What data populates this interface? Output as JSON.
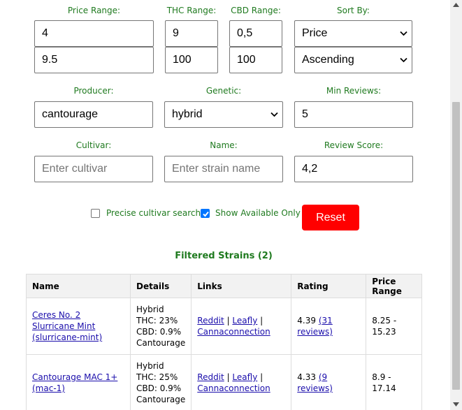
{
  "filters": {
    "price_range": {
      "label": "Price Range:",
      "min": "4",
      "max": "9.5"
    },
    "thc_range": {
      "label": "THC Range:",
      "min": "9",
      "max": "100"
    },
    "cbd_range": {
      "label": "CBD Range:",
      "min": "0,5",
      "max": "100"
    },
    "sort_by": {
      "label": "Sort By:",
      "field": "Price",
      "order": "Ascending"
    },
    "producer": {
      "label": "Producer:",
      "value": "cantourage"
    },
    "genetic": {
      "label": "Genetic:",
      "value": "hybrid"
    },
    "min_reviews": {
      "label": "Min Reviews:",
      "value": "5"
    },
    "cultivar": {
      "label": "Cultivar:",
      "placeholder": "Enter cultivar",
      "value": ""
    },
    "name": {
      "label": "Name:",
      "placeholder": "Enter strain name",
      "value": ""
    },
    "review_score": {
      "label": "Review Score:",
      "value": "4,2"
    }
  },
  "options": {
    "precise_cultivar": {
      "label": "Precise cultivar search",
      "checked": false
    },
    "available_only": {
      "label": "Show Available Only",
      "checked": true
    },
    "reset_label": "Reset"
  },
  "results": {
    "title": "Filtered Strains (2)",
    "columns": [
      "Name",
      "Details",
      "Links",
      "Rating",
      "Price Range"
    ],
    "rows": [
      {
        "name": "Ceres No. 2 Slurricane Mint",
        "cultivar": "(slurricane-mint)",
        "details": [
          "Hybrid",
          "THC: 23%",
          "CBD: 0.9%",
          "Cantourage"
        ],
        "links": [
          "Reddit",
          "Leafly",
          "Cannaconnection"
        ],
        "rating": "4.39",
        "reviews": "(31 reviews)",
        "price_range": "8.25 - 15.23"
      },
      {
        "name": "Cantourage MAC 1+",
        "cultivar": "(mac-1)",
        "details": [
          "Hybrid",
          "THC: 25%",
          "CBD: 0.9%",
          "Cantourage"
        ],
        "links": [
          "Reddit",
          "Leafly",
          "Cannaconnection"
        ],
        "rating": "4.33",
        "reviews": "(9 reviews)",
        "price_range": "8.9 - 17.14"
      }
    ]
  },
  "colors": {
    "label_green": "#1f7a1f",
    "reset_red": "#ff0000",
    "checkbox_blue": "#0075ff"
  }
}
